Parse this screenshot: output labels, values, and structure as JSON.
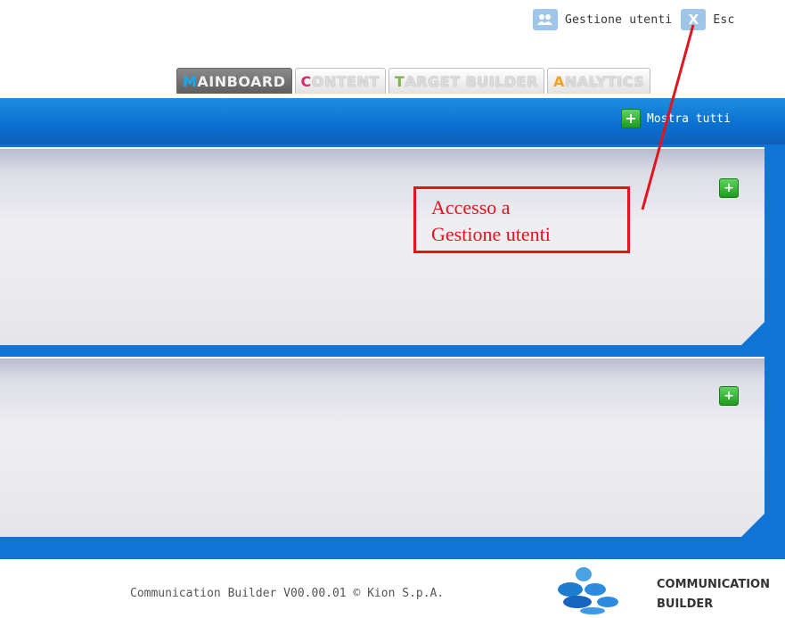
{
  "topbar": {
    "user_mgmt_label": "Gestione utenti",
    "exit_label": "Esc"
  },
  "tabs": [
    {
      "first": "M",
      "rest": "AINBOARD",
      "accent": "#19a8ef",
      "active": true
    },
    {
      "first": "C",
      "rest": "ONTENT",
      "accent": "#e0266f",
      "active": false
    },
    {
      "first": "T",
      "rest": "ARGET BUILDER",
      "accent": "#7ab34a",
      "active": false
    },
    {
      "first": "A",
      "rest": "NALYTICS",
      "accent": "#f4a223",
      "active": false
    }
  ],
  "header": {
    "show_all_label": "Mostra tutti"
  },
  "annotation": {
    "line1": "Accesso a",
    "line2": "Gestione utenti"
  },
  "footer": {
    "copyright": "Communication Builder V00.00.01 © Kion S.p.A.",
    "logo_line1": "COMMUNICATION",
    "logo_line2": "BUILDER"
  },
  "colors": {
    "header_blue": "#0a6fd0",
    "annotation_red": "#e2141c",
    "add_green": "#2fb52f"
  }
}
